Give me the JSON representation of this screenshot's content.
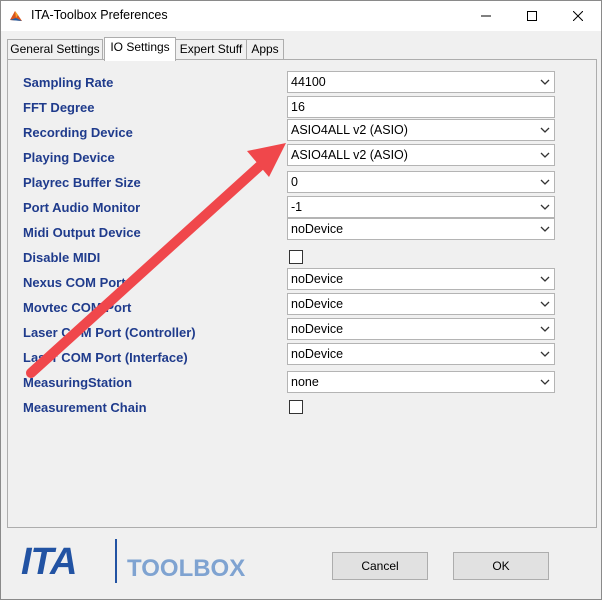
{
  "window": {
    "title": "ITA-Toolbox Preferences"
  },
  "tabs": [
    {
      "label": "General Settings"
    },
    {
      "label": "IO Settings"
    },
    {
      "label": "Expert Stuff"
    },
    {
      "label": "Apps"
    }
  ],
  "settings": [
    {
      "label": "Sampling Rate",
      "control": "combo",
      "value": "44100"
    },
    {
      "label": "FFT Degree",
      "control": "text",
      "value": "16"
    },
    {
      "label": "Recording Device",
      "control": "combo",
      "value": "ASIO4ALL v2 (ASIO)"
    },
    {
      "label": "Playing Device",
      "control": "combo",
      "value": "ASIO4ALL v2 (ASIO)"
    },
    {
      "label": "Playrec Buffer Size",
      "control": "combo",
      "value": "0"
    },
    {
      "label": "Port Audio Monitor",
      "control": "combo",
      "value": "-1"
    },
    {
      "label": "Midi Output Device",
      "control": "combo",
      "value": "noDevice"
    },
    {
      "label": "Disable MIDI",
      "control": "checkbox",
      "checked": false
    },
    {
      "label": "Nexus COM Port",
      "control": "combo",
      "value": "noDevice"
    },
    {
      "label": "Movtec COM Port",
      "control": "combo",
      "value": "noDevice"
    },
    {
      "label": "Laser COM Port (Controller)",
      "control": "combo",
      "value": "noDevice"
    },
    {
      "label": "Laser COM Port (Interface)",
      "control": "combo",
      "value": "noDevice"
    },
    {
      "label": "MeasuringStation",
      "control": "combo",
      "value": "none"
    },
    {
      "label": "Measurement Chain",
      "control": "checkbox",
      "checked": false
    }
  ],
  "buttons": {
    "cancel": "Cancel",
    "ok": "OK"
  },
  "logo": {
    "ita": "ITA",
    "toolbox": "TOOLBOX"
  },
  "colors": {
    "label": "#1f3b8c",
    "arrow": "#f0474b",
    "logo_dark": "#2253a3",
    "logo_light": "#7fa3d1"
  }
}
